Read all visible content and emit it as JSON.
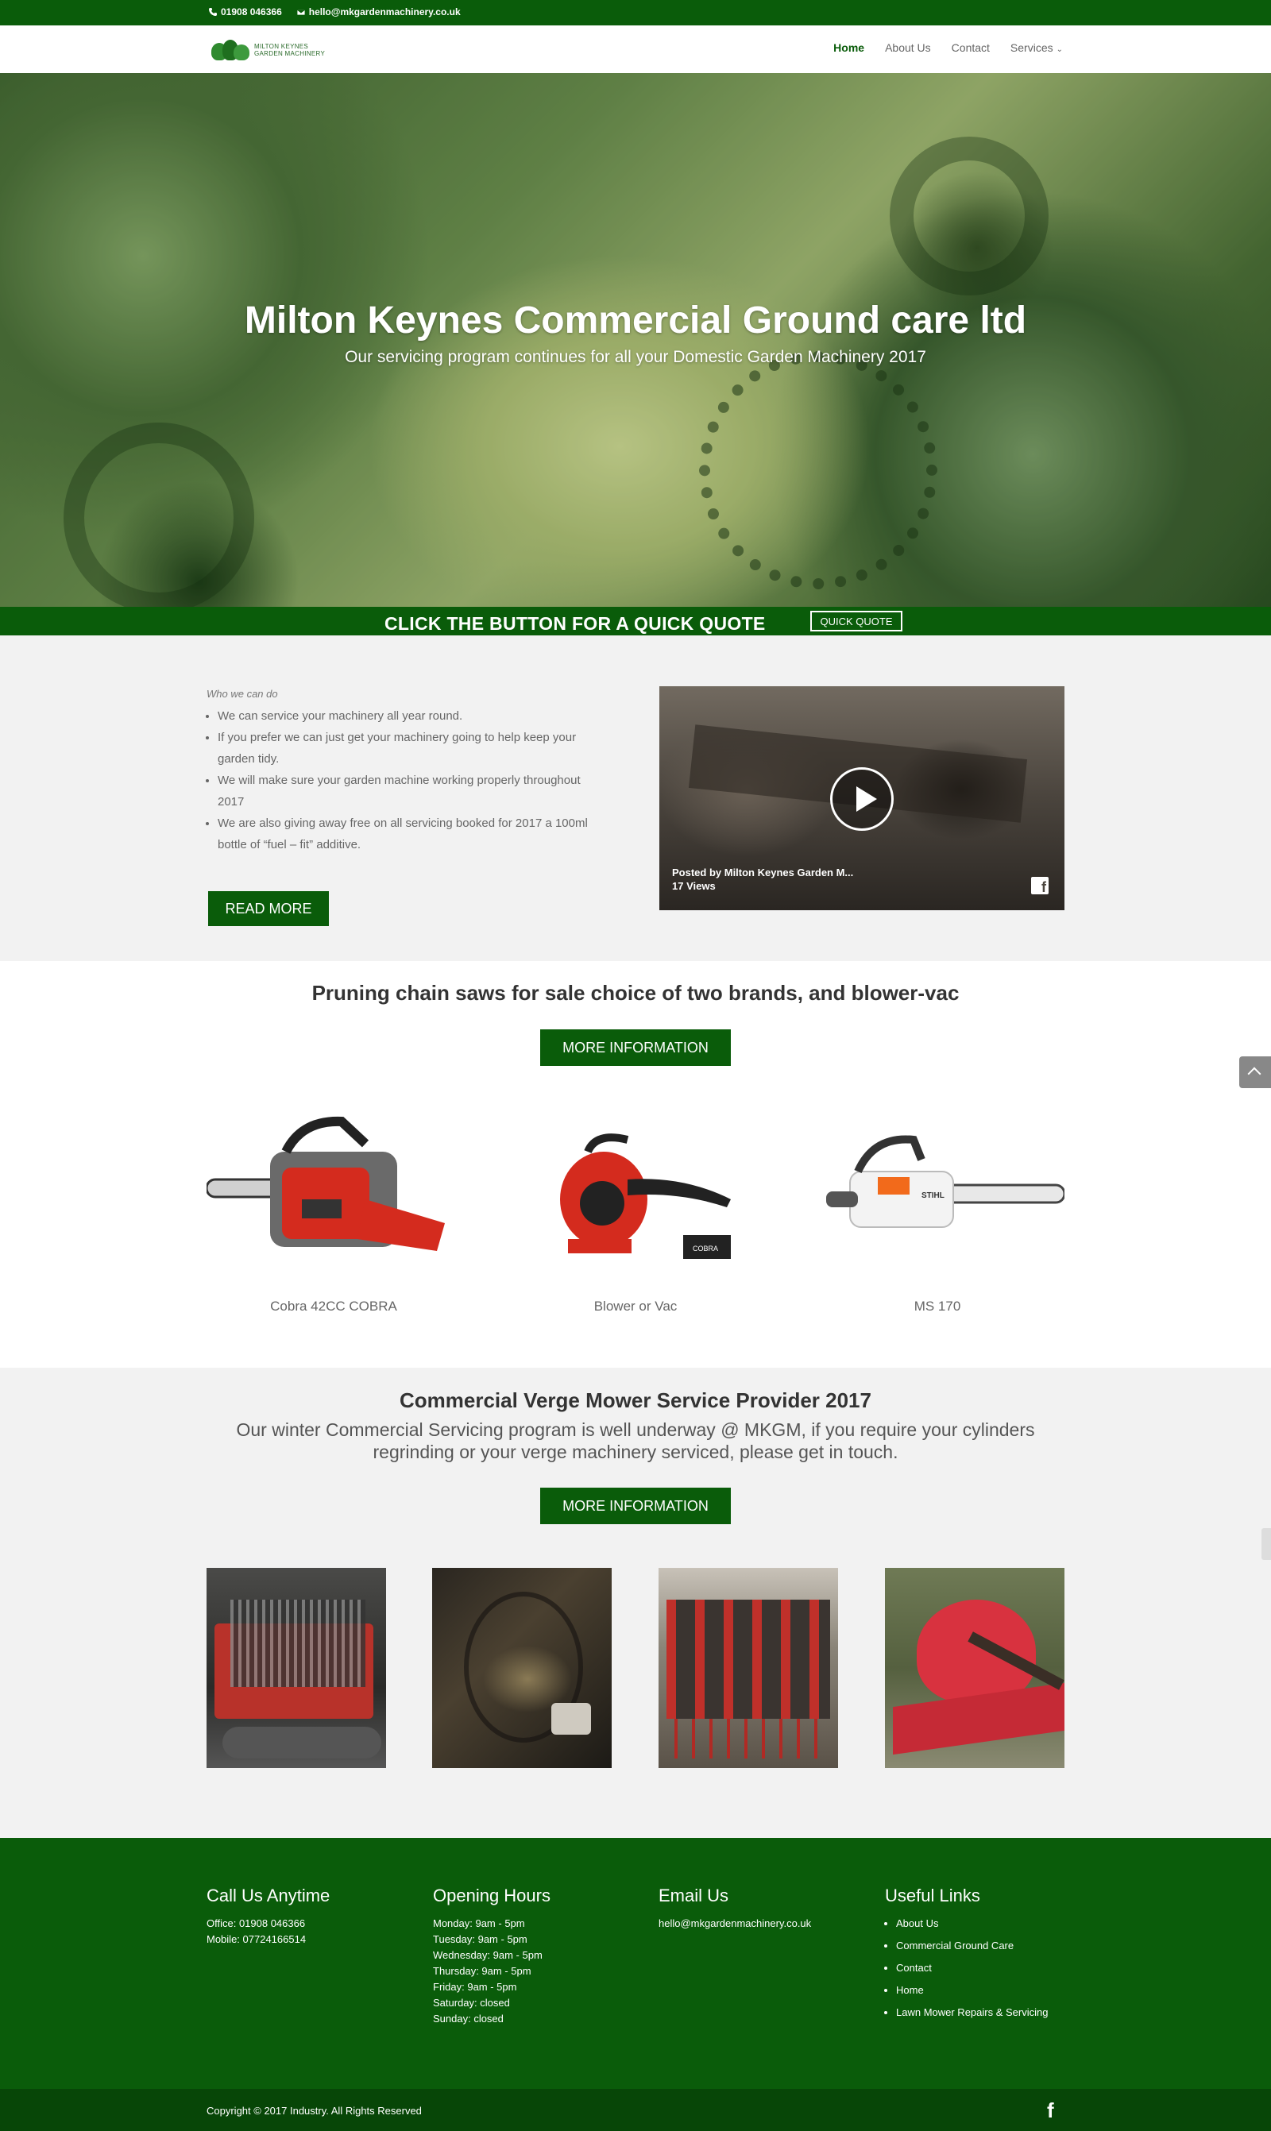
{
  "topbar": {
    "phone": "01908 046366",
    "email": "hello@mkgardenmachinery.co.uk"
  },
  "header": {
    "logo_line1": "MILTON KEYNES",
    "logo_line2": "GARDEN MACHINERY",
    "nav": [
      {
        "label": "Home"
      },
      {
        "label": "About Us"
      },
      {
        "label": "Contact"
      },
      {
        "label": "Services"
      }
    ]
  },
  "hero": {
    "title": "Milton Keynes Commercial Ground care ltd",
    "subtitle": "Our servicing program continues for all your Domestic  Garden Machinery 2017"
  },
  "quotebar": {
    "text": "CLICK THE BUTTON FOR A QUICK QUOTE",
    "button": "QUICK QUOTE"
  },
  "who": {
    "heading": "Who we can do",
    "items": [
      "We can service your machinery all year round.",
      "If you prefer we can just get your machinery going to help keep your garden tidy.",
      "We will make sure your garden machine working properly throughout 2017",
      "We are also giving away free on all servicing booked for 2017 a 100ml bottle of “fuel – fit” additive."
    ],
    "button": "READ MORE",
    "video": {
      "posted": "Posted by Milton Keynes Garden M...",
      "views": "17 Views"
    }
  },
  "products": {
    "title": "Pruning chain saws for sale choice of two brands, and blower-vac",
    "button": "MORE INFORMATION",
    "items": [
      {
        "caption": "Cobra 42CC COBRA"
      },
      {
        "caption": "Blower or Vac",
        "brand": "COBRA"
      },
      {
        "caption": "MS 170",
        "brand": "STIHL"
      }
    ]
  },
  "verge": {
    "title": "Commercial Verge Mower Service Provider 2017",
    "text": "Our winter Commercial Servicing program is well underway @ MKGM, if you require your cylinders regrinding or your verge machinery serviced, please get in touch.",
    "button": "MORE INFORMATION"
  },
  "footer": {
    "call": {
      "title": "Call Us Anytime",
      "office": "Office: 01908 046366",
      "mobile": "Mobile: 07724166514"
    },
    "hours": {
      "title": "Opening Hours",
      "lines": [
        "Monday: 9am - 5pm",
        "Tuesday: 9am - 5pm",
        "Wednesday: 9am - 5pm",
        "Thursday: 9am - 5pm",
        "Friday: 9am - 5pm",
        "Saturday: closed",
        "Sunday: closed"
      ]
    },
    "email": {
      "title": "Email Us",
      "address": "hello@mkgardenmachinery.co.uk"
    },
    "links": {
      "title": "Useful Links",
      "items": [
        "About Us",
        "Commercial Ground Care",
        "Contact",
        "Home",
        "Lawn Mower Repairs & Servicing"
      ]
    }
  },
  "bottom": {
    "copyright": "Copyright © 2017 Industry. All Rights Reserved"
  },
  "colors": {
    "brand_green": "#0a5c0a",
    "dark_green": "#074607",
    "light_bg": "#f2f2f2"
  }
}
